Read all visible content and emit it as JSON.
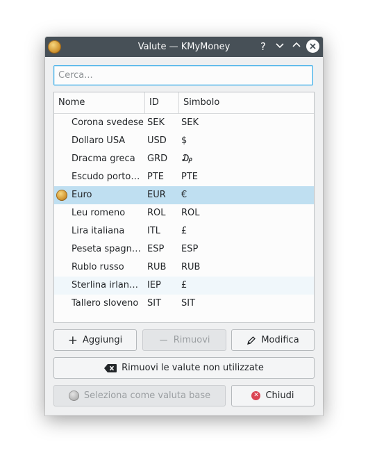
{
  "window": {
    "title": "Valute — KMyMoney",
    "help_glyph": "?",
    "minimize_glyph": "⌄",
    "maximize_glyph": "⌃",
    "close_glyph": "✕",
    "app_icon": "kmymoney-coin-icon"
  },
  "search": {
    "placeholder": "Cerca...",
    "value": ""
  },
  "table": {
    "columns": [
      "Nome",
      "ID",
      "Simbolo"
    ],
    "rows": [
      {
        "name": "Corona svedese",
        "id": "SEK",
        "symbol": "SEK"
      },
      {
        "name": "Dollaro USA",
        "id": "USD",
        "symbol": "$"
      },
      {
        "name": "Dracma greca",
        "id": "GRD",
        "symbol": "₯"
      },
      {
        "name": "Escudo portog…",
        "id": "PTE",
        "symbol": "PTE"
      },
      {
        "name": "Euro",
        "id": "EUR",
        "symbol": "€",
        "base": true
      },
      {
        "name": "Leu romeno",
        "id": "ROL",
        "symbol": "ROL"
      },
      {
        "name": "Lira italiana",
        "id": "ITL",
        "symbol": "£"
      },
      {
        "name": "Peseta spagnola",
        "id": "ESP",
        "symbol": "ESP"
      },
      {
        "name": "Rublo russo",
        "id": "RUB",
        "symbol": "RUB"
      },
      {
        "name": "Sterlina irlande…",
        "id": "IEP",
        "symbol": "£"
      },
      {
        "name": "Tallero sloveno",
        "id": "SIT",
        "symbol": "SIT"
      }
    ],
    "selected_index": 4,
    "hover_index": 9
  },
  "buttons": {
    "add": "Aggiungi",
    "remove": "Rimuovi",
    "edit": "Modifica",
    "remove_unused": "Rimuovi le valute non utilizzate",
    "set_base": "Seleziona come valuta base",
    "close": "Chiudi"
  },
  "icons": {
    "add": "plus-icon",
    "remove": "minus-icon",
    "edit": "pencil-icon",
    "remove_unused": "clear-icon",
    "set_base": "coin-icon",
    "close": "close-circle-icon"
  },
  "colors": {
    "titlebar": "#475057",
    "selection": "#bfdff1",
    "focus": "#3daee9",
    "close_red": "#da4453"
  }
}
